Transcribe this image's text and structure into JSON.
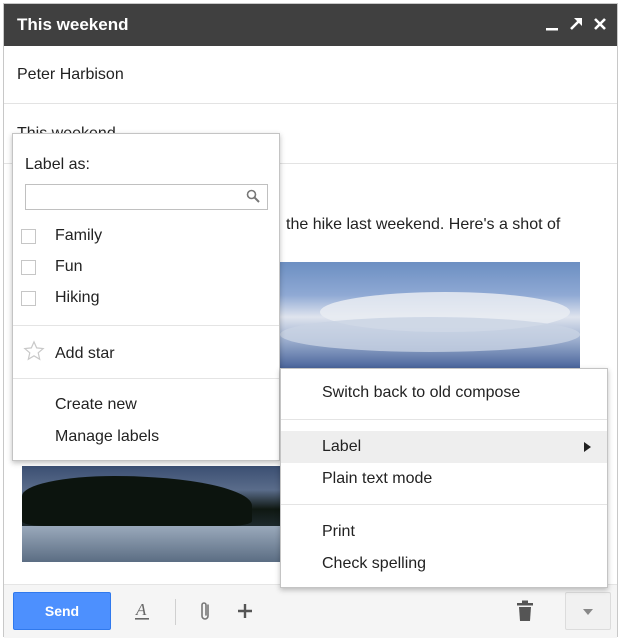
{
  "window": {
    "title": "This weekend"
  },
  "fields": {
    "to": "Peter Harbison",
    "subject": "This weekend"
  },
  "body": {
    "text": "the hike last weekend.  Here's a shot of"
  },
  "toolbar": {
    "send_label": "Send"
  },
  "label_popup": {
    "title": "Label as:",
    "search_value": "",
    "labels": [
      "Family",
      "Fun",
      "Hiking"
    ],
    "add_star": "Add star",
    "create_new": "Create new",
    "manage_labels": "Manage labels"
  },
  "more_menu": {
    "items": [
      "Switch back to old compose",
      "Label",
      "Plain text mode",
      "Print",
      "Check spelling"
    ]
  },
  "icons": {
    "minimize": "minimize-icon",
    "popout": "popout-icon",
    "close": "close-icon",
    "search": "search-icon",
    "star": "star-icon",
    "formatting": "text-format-icon",
    "attach": "paperclip-icon",
    "insert": "plus-icon",
    "discard": "trash-icon",
    "more": "chevron-down-icon"
  },
  "colors": {
    "titlebar": "#404040",
    "send": "#4d90fe",
    "highlight": "#eeeeee"
  }
}
